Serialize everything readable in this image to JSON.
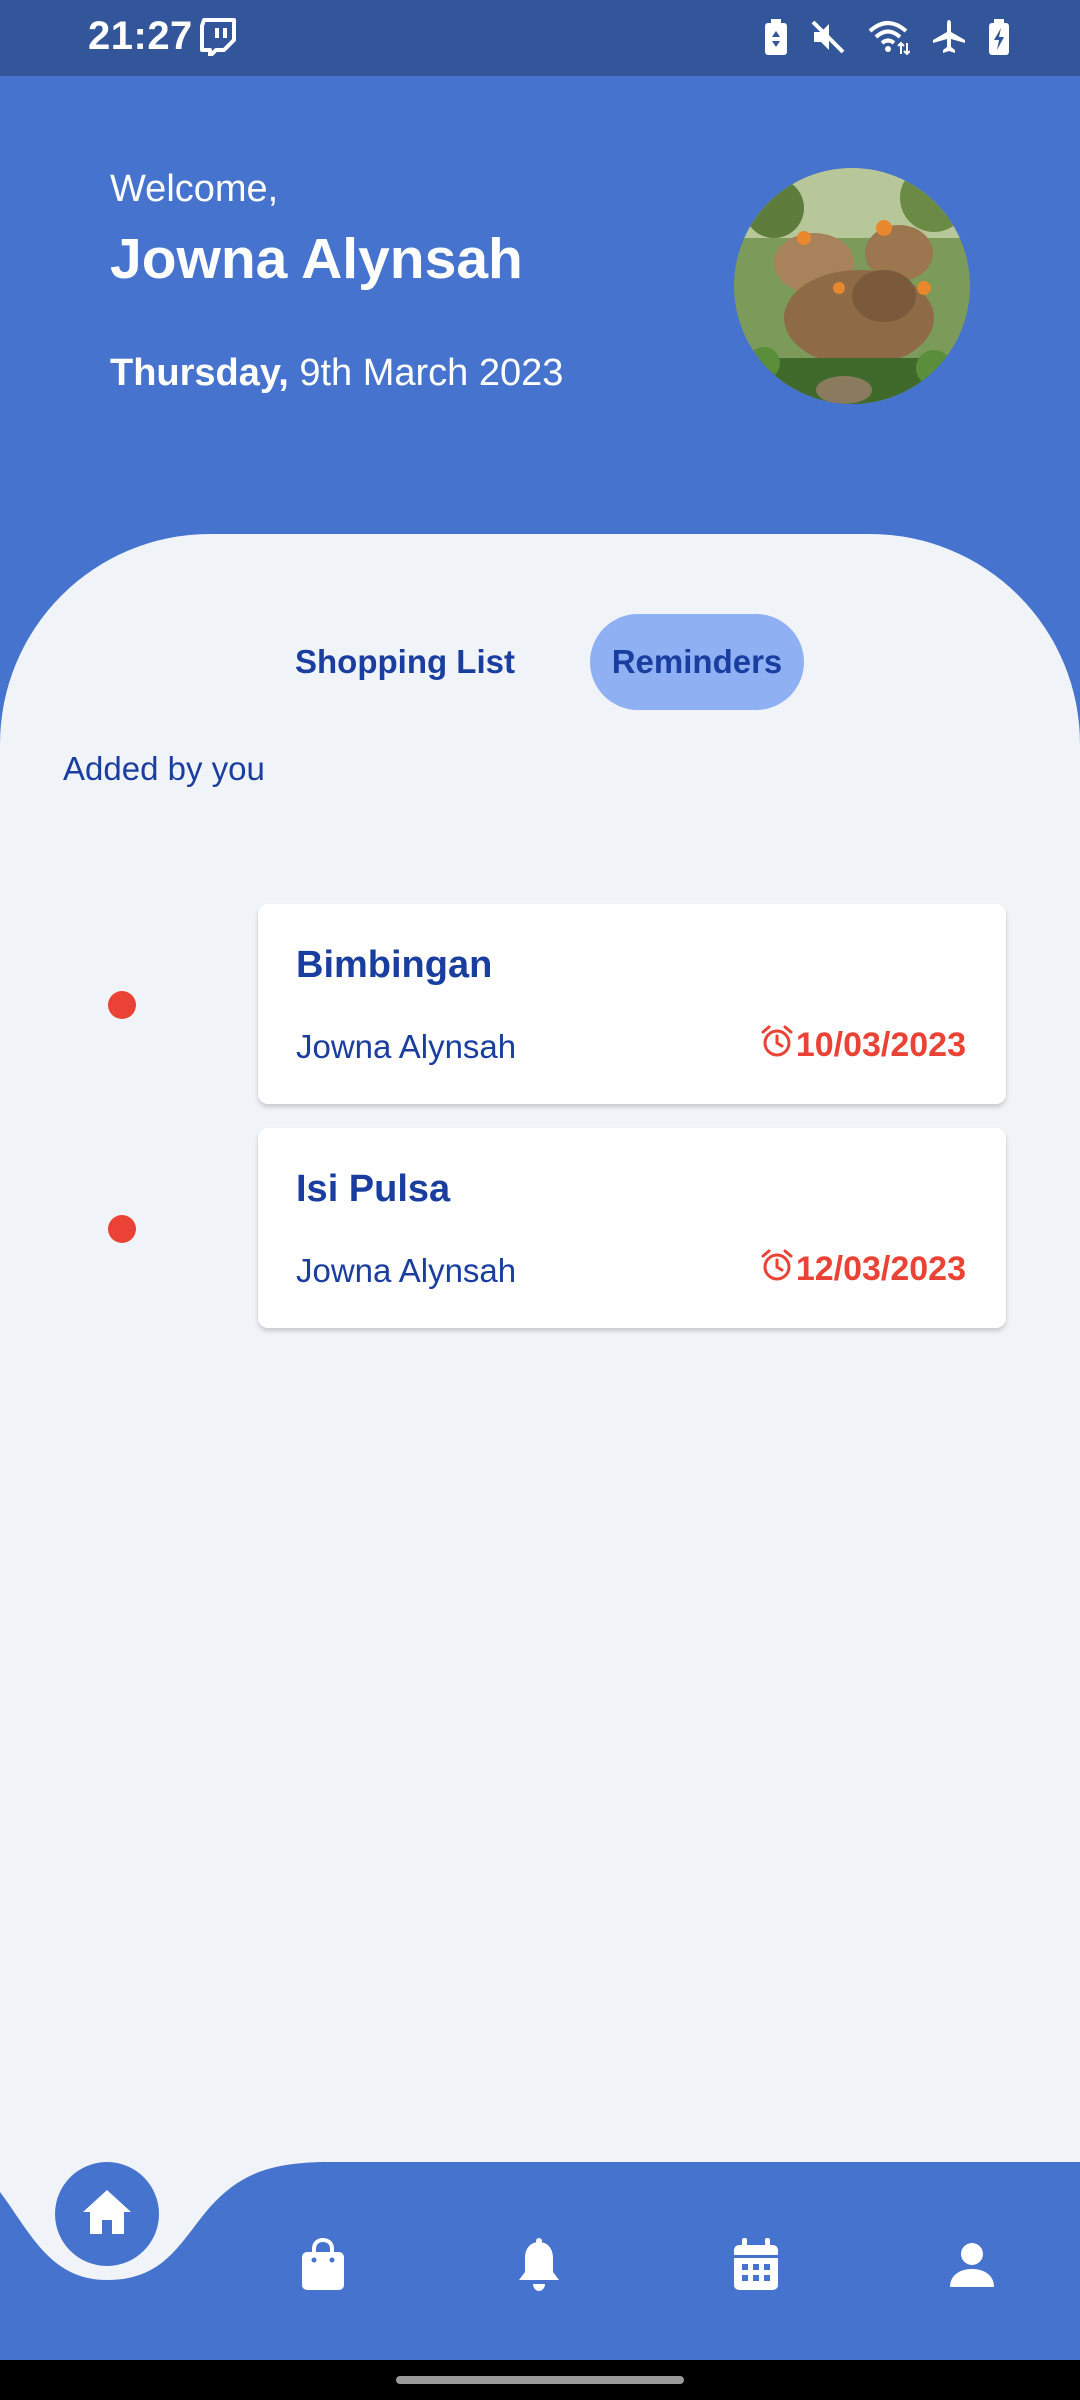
{
  "status_bar": {
    "time": "21:27",
    "left_icon": "twitch-icon",
    "right_icons": [
      "battery-saver-icon",
      "mute-icon",
      "wifi-icon",
      "airplane-mode-icon",
      "battery-charging-icon"
    ]
  },
  "header": {
    "greeting": "Welcome,",
    "user_name": "Jowna Alynsah",
    "weekday": "Thursday,",
    "date": "9th March 2023",
    "avatar": "profile-photo-capybaras"
  },
  "tabs": [
    {
      "label": "Shopping List",
      "selected": false
    },
    {
      "label": "Reminders",
      "selected": true
    }
  ],
  "section_label": "Added by you",
  "reminders": [
    {
      "title": "Bimbingan",
      "owner": "Jowna Alynsah",
      "due": "10/03/2023",
      "icon": "alarm-icon"
    },
    {
      "title": "Isi Pulsa",
      "owner": "Jowna Alynsah",
      "due": "12/03/2023",
      "icon": "alarm-icon"
    }
  ],
  "bottom_nav": [
    {
      "name": "home",
      "icon": "home-icon",
      "active": true
    },
    {
      "name": "shopping",
      "icon": "shopping-bag-icon",
      "active": false
    },
    {
      "name": "notifications",
      "icon": "bell-icon",
      "active": false
    },
    {
      "name": "calendar",
      "icon": "calendar-icon",
      "active": false
    },
    {
      "name": "profile",
      "icon": "person-icon",
      "active": false
    }
  ],
  "colors": {
    "status_bar": "#33559a",
    "header": "#4573cd",
    "background": "#f0f4f9",
    "primary_text": "#1a3ea0",
    "selected_tab": "#8fb0f3",
    "accent_red": "#ea4335",
    "card": "#ffffff"
  }
}
